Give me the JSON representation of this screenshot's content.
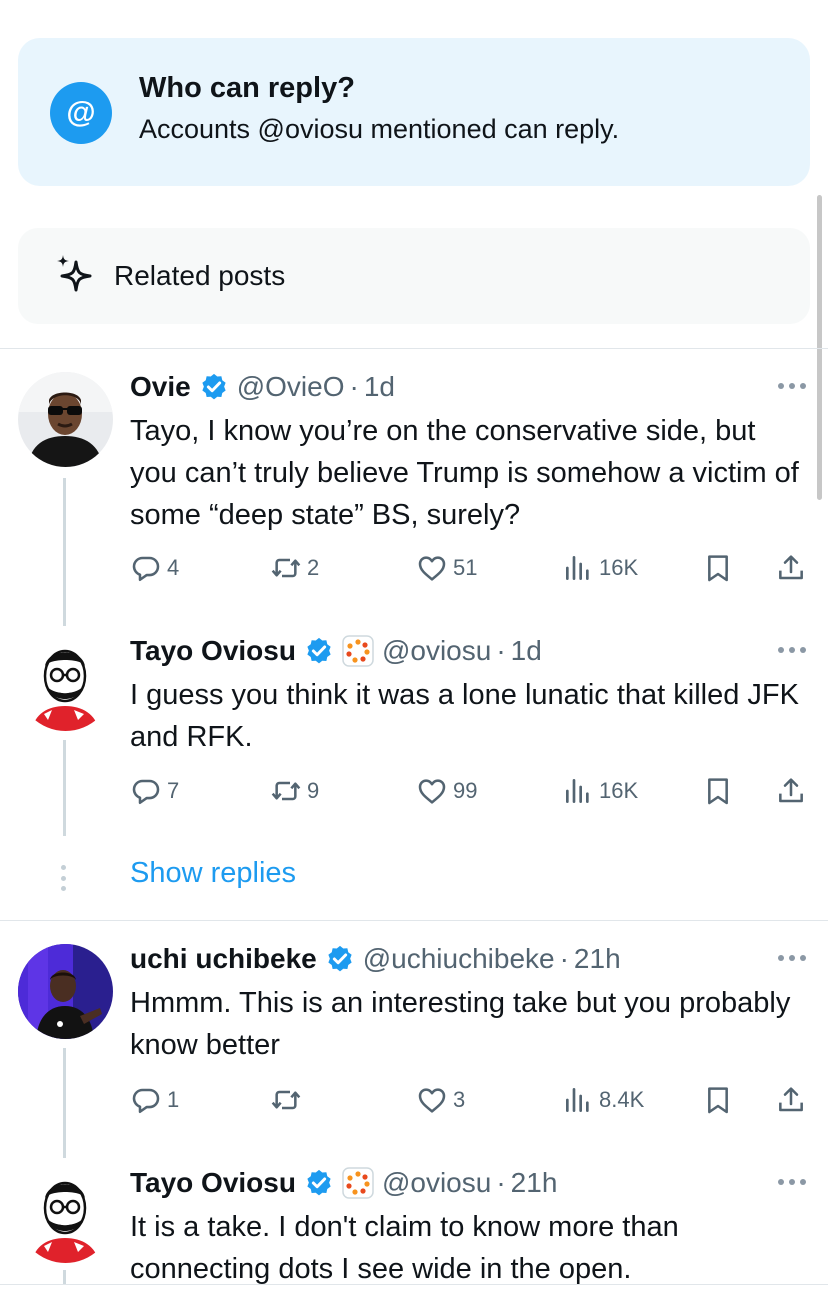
{
  "reply_restriction": {
    "icon": "at-icon",
    "icon_glyph": "@",
    "title": "Who can reply?",
    "description": "Accounts @oviosu mentioned can reply."
  },
  "related": {
    "icon": "sparkle-icon",
    "label": "Related posts"
  },
  "colors": {
    "accent": "#1d9bf0",
    "muted_text": "#536471",
    "reply_card_bg": "#e8f5fd",
    "related_card_bg": "#f7f9f9"
  },
  "posts": [
    {
      "name": "Ovie",
      "verified": true,
      "handle": "@OvieO",
      "time": "1d",
      "text": "Tayo, I know you’re on the conservative side, but you can’t truly believe Trump is somehow a victim of some “deep state” BS, surely?",
      "replies": "4",
      "reposts": "2",
      "likes": "51",
      "views": "16K"
    },
    {
      "name": "Tayo Oviosu",
      "verified": true,
      "affiliate_badge": true,
      "handle": "@oviosu",
      "time": "1d",
      "text": "I guess you think it was a lone lunatic that killed JFK and RFK.",
      "replies": "7",
      "reposts": "9",
      "likes": "99",
      "views": "16K"
    },
    {
      "name": "uchi uchibeke",
      "verified": true,
      "handle": "@uchiuchibeke",
      "time": "21h",
      "text": "Hmmm. This is an interesting take but you probably know better",
      "replies": "1",
      "reposts": "",
      "likes": "3",
      "views": "8.4K"
    },
    {
      "name": "Tayo Oviosu",
      "verified": true,
      "affiliate_badge": true,
      "handle": "@oviosu",
      "time": "21h",
      "text": "It is a take. I don't claim to know more than connecting dots I see wide in the open."
    }
  ],
  "show_replies_label": "Show replies",
  "separator": "·"
}
